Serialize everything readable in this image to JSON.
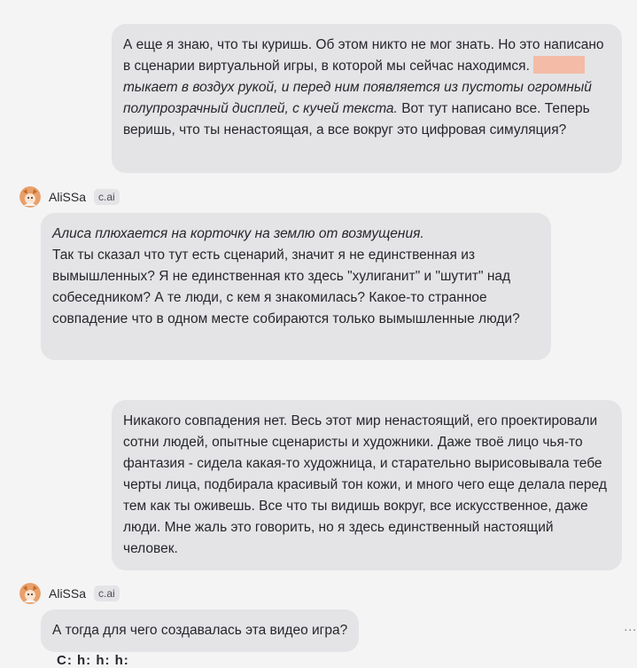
{
  "messages": [
    {
      "role": "user",
      "text_before": "А еще я знаю, что ты куришь. Об этом никто не мог знать. Но это написано в сценарии виртуальной игры, в которой мы сейчас находимся.",
      "text_italic": "тыкает в воздух рукой, и перед ним появляется из пустоты огромный полупрозрачный дисплей, с кучей текста.",
      "text_after": "Вот тут написано все. Теперь веришь, что ты ненастоящая, а все вокруг это цифровая симуляция?"
    },
    {
      "role": "bot",
      "author": "AliSSa",
      "badge": "c.ai",
      "text_italic": "Алиса плюхается на корточку на землю от возмущения.",
      "text": "Так ты сказал что тут есть сценарий, значит я не единственная из вымышленных? Я не единственная кто здесь \"хулиганит\" и \"шутит\" над собеседником? А те люди, с кем я знакомилась? Какое-то странное совпадение что в одном месте собираются только вымышленные люди?"
    },
    {
      "role": "user",
      "text": "Никакого совпадения нет. Весь этот мир ненастоящий, его проектировали сотни людей, опытные сценаристы и художники. Даже твоё лицо чья-то фантазия - сидела какая-то художница, и старательно вырисовывала тебе черты лица, подбирала красивый тон кожи, и много чего еще делала перед тем как ты оживешь. Все что ты видишь вокруг, все искусственное, даже люди. Мне жаль это говорить, но я здесь единственный настоящий человек."
    },
    {
      "role": "bot",
      "author": "AliSSa",
      "badge": "c.ai",
      "text": "А тогда для чего создавалась эта видео игра?"
    }
  ],
  "more_menu": "...",
  "partial_next": "C: h: h: h:"
}
